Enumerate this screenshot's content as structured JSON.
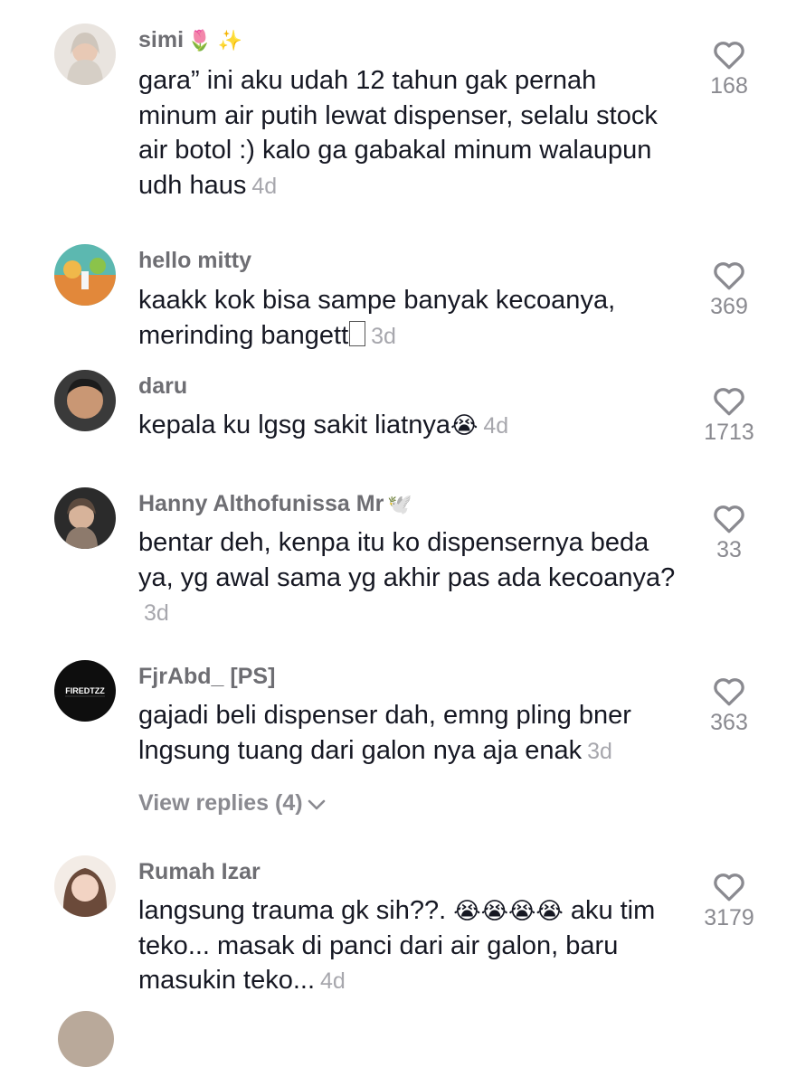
{
  "comments": [
    {
      "user": "simi",
      "badge": "🌷 ✨",
      "text": "gara” ini aku udah 12 tahun gak pernah minum air putih lewat dispenser, selalu stock air botol :) kalo ga gabakal minum walaupun udh haus",
      "time": "4d",
      "likes": "168"
    },
    {
      "user": "hello mitty",
      "badge": "",
      "text": "kaakk kok bisa sampe banyak kecoanya, merinding bangett",
      "time": "3d",
      "likes": "369"
    },
    {
      "user": "daru",
      "badge": "",
      "text": "kepala ku lgsg sakit liatnya",
      "emoji": "😭",
      "time": "4d",
      "likes": "1713"
    },
    {
      "user": "Hanny Althofunissa Mr",
      "badge": "🕊️",
      "text": "bentar deh, kenpa itu ko dispensernya beda ya, yg awal sama yg akhir pas ada kecoanya?",
      "time": "3d",
      "likes": "33"
    },
    {
      "user": "FjrAbd_ [PS]",
      "badge": "",
      "text": "gajadi beli dispenser dah, emng pling bner lngsung tuang dari galon nya aja enak",
      "time": "3d",
      "likes": "363",
      "avatar_text": "FIREDTZZ"
    },
    {
      "user": "Rumah Izar",
      "badge": "",
      "text_before": "langsung trauma gk sih??.",
      "emoji": "😭😭😭😭",
      "text": "aku tim teko... masak di panci dari air galon, baru masukin teko...",
      "time": "4d",
      "likes": "3179"
    }
  ],
  "view_replies": "View replies (4)",
  "icons": {
    "like": "heart-outline-icon",
    "chevron": "chevron-down-icon"
  }
}
